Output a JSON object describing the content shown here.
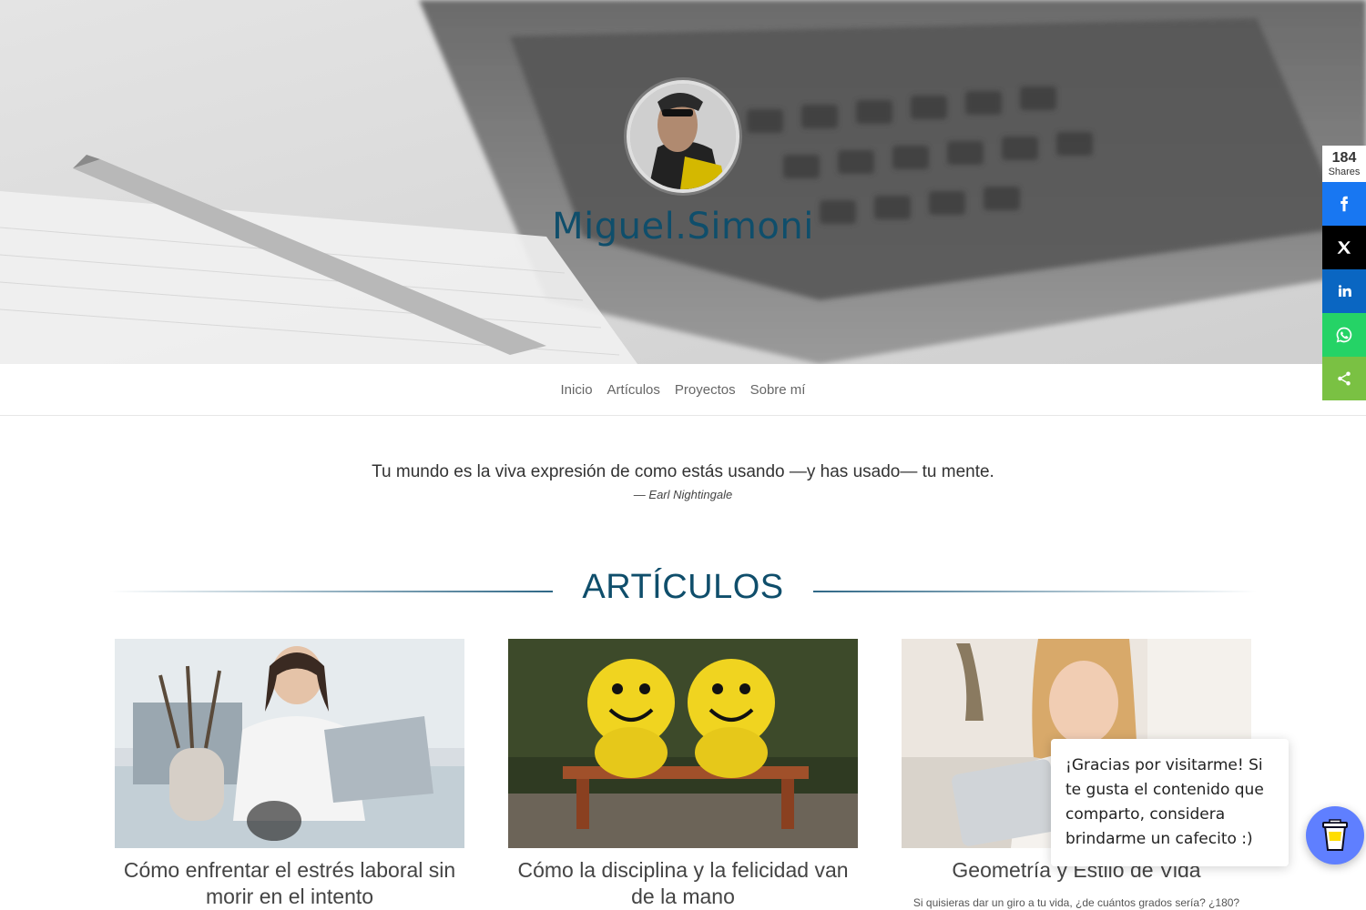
{
  "site": {
    "title": "Miguel.Simoni"
  },
  "nav": {
    "items": [
      {
        "label": "Inicio"
      },
      {
        "label": "Artículos"
      },
      {
        "label": "Proyectos"
      },
      {
        "label": "Sobre mí"
      }
    ]
  },
  "quote": {
    "text": "Tu mundo es la viva expresión de como estás usando —y has usado— tu mente.",
    "author": "— Earl Nightingale"
  },
  "articles": {
    "heading": "ARTÍCULOS",
    "cards": [
      {
        "title": "Cómo enfrentar el estrés laboral sin morir en el intento",
        "excerpt": ""
      },
      {
        "title": "Cómo la disciplina y la felicidad van de la mano",
        "excerpt": ""
      },
      {
        "title": "Geometría y Estilo de Vida",
        "excerpt": "Si quisieras dar un giro a tu vida, ¿de cuántos grados sería? ¿180?"
      }
    ]
  },
  "share": {
    "count": "184",
    "label": "Shares",
    "buttons": [
      {
        "name": "facebook",
        "color": "#1877f2"
      },
      {
        "name": "x",
        "color": "#000000"
      },
      {
        "name": "linkedin",
        "color": "#0a66c2"
      },
      {
        "name": "whatsapp",
        "color": "#25d366"
      },
      {
        "name": "share",
        "color": "#7ac143"
      }
    ]
  },
  "popup": {
    "text": "¡Gracias por visitarme! Si te gusta el contenido que comparto, considera brindarme un cafecito :)"
  },
  "colors": {
    "accent": "#0f4e6b",
    "coffee_button": "#5f7fff"
  }
}
